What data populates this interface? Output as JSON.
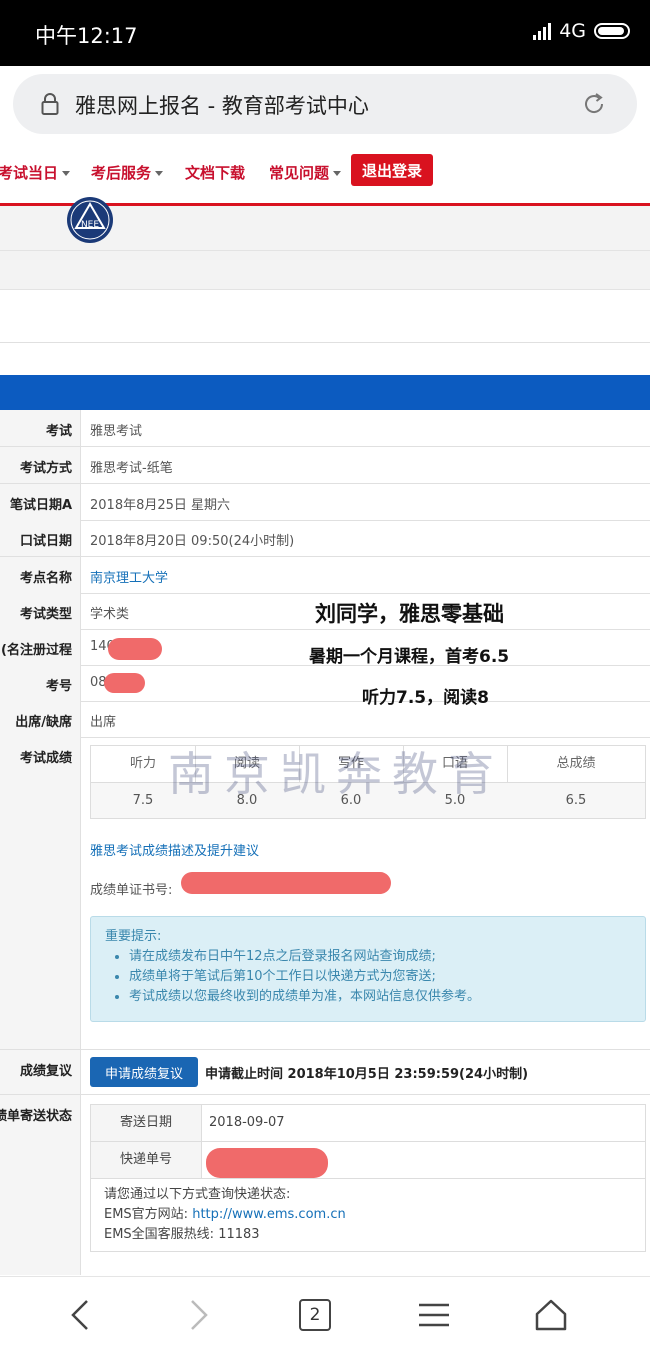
{
  "status_bar": {
    "time": "中午12:17",
    "network": "4G"
  },
  "browser": {
    "title": "雅思网上报名 - 教育部考试中心"
  },
  "nav": [
    {
      "label": "考试当日",
      "has_dropdown": true
    },
    {
      "label": "考后服务",
      "has_dropdown": true
    },
    {
      "label": "文档下载",
      "has_dropdown": false
    },
    {
      "label": "常见问题",
      "has_dropdown": true
    }
  ],
  "logout_label": "退出登录",
  "rows": [
    {
      "label": "考试",
      "value": "雅思考试"
    },
    {
      "label": "考试方式",
      "value": "雅思考试-纸笔"
    },
    {
      "label": "笔试日期A",
      "value": "2018年8月25日 星期六"
    },
    {
      "label": "口试日期",
      "value": "2018年8月20日 09:50(24小时制)"
    },
    {
      "label": "考点名称",
      "value": "南京理工大学"
    },
    {
      "label": "考试类型",
      "value": "学术类"
    },
    {
      "label": "名注册过程)",
      "value": "140"
    },
    {
      "label": "考号",
      "value": "08"
    },
    {
      "label": "出席/缺席",
      "value": "出席"
    }
  ],
  "score_section": {
    "label": "考试成绩",
    "columns": [
      "听力",
      "阅读",
      "写作",
      "口语",
      "总成绩"
    ],
    "values": [
      "7.5",
      "8.0",
      "6.0",
      "5.0",
      "6.5"
    ],
    "link": "雅思考试成绩描述及提升建议",
    "cert_label": "成绩单证书号:"
  },
  "watermark": "南京凯奔教育",
  "notice": {
    "title": "重要提示:",
    "items": [
      "请在成绩发布日中午12点之后登录报名网站查询成绩;",
      "成绩单将于笔试后第10个工作日以快递方式为您寄送;",
      "考试成绩以您最终收到的成绩单为准，本网站信息仅供参考。"
    ]
  },
  "annotations": {
    "line1": "刘同学，雅思零基础",
    "line2": "暑期一个月课程，首考6.5",
    "line3": "听力7.5，阅读8"
  },
  "review": {
    "label": "成绩复议",
    "button": "申请成绩复议",
    "deadline": "申请截止时间 2018年10月5日 23:59:59(24小时制)"
  },
  "mail": {
    "label": "绩单寄送状态",
    "send_date_label": "寄送日期",
    "send_date": "2018-09-07",
    "tracking_label": "快递单号",
    "info_line1": "请您通过以下方式查询快递状态:",
    "info_line2_prefix": "EMS官方网站: ",
    "info_line2_link": "http://www.ems.com.cn",
    "info_line3": "EMS全国客服热线: 11183"
  },
  "bottom_bar": {
    "tab_count": "2"
  },
  "colors": {
    "accent_red": "#d9121f",
    "blue_band": "#0c5bc0",
    "link_blue": "#1570b8"
  }
}
